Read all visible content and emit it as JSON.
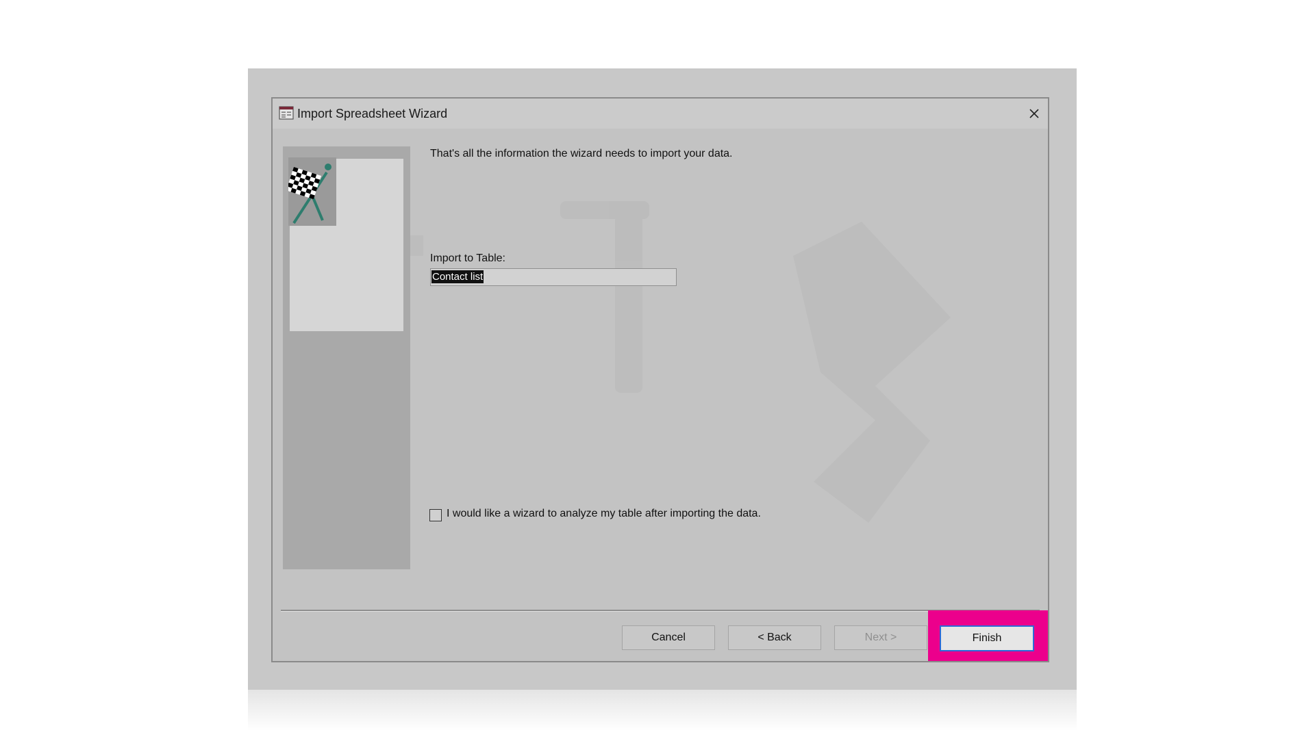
{
  "window": {
    "title": "Import Spreadsheet Wizard"
  },
  "main": {
    "intro": "That's all the information the wizard needs to import your data.",
    "import_label": "Import to Table:",
    "import_value": "Contact list",
    "analyze_label": "I would like a wizard to analyze my table after importing the data.",
    "analyze_checked": false
  },
  "buttons": {
    "cancel": "Cancel",
    "back": "< Back",
    "next": "Next >",
    "finish": "Finish"
  },
  "colors": {
    "highlight": "#ec008c",
    "focus_border": "#2d6ad6"
  },
  "icons": {
    "app": "access-table-icon",
    "close": "close-icon",
    "wizard_art": "checkered-flag-icon"
  }
}
